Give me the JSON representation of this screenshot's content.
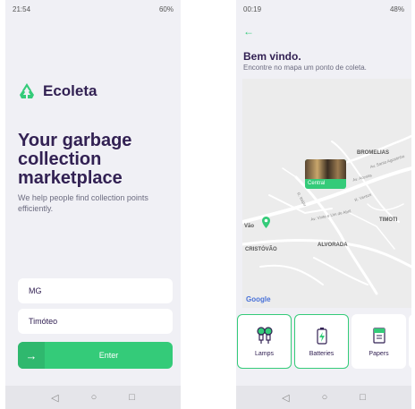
{
  "left_screen": {
    "status": {
      "time": "21:54",
      "battery": "60%"
    },
    "app_name": "Ecoleta",
    "headline": "Your garbage collection marketplace",
    "subtitle": "We help people find collection points efficiently.",
    "uf_value": "MG",
    "city_value": "Timóteo",
    "enter_label": "Enter",
    "enter_icon": "→",
    "nav": {
      "back": "◁",
      "home": "○",
      "recent": "□"
    }
  },
  "right_screen": {
    "status": {
      "time": "00:19",
      "battery": "48%"
    },
    "back_icon": "←",
    "title": "Bem vindo.",
    "subtitle": "Encontre no mapa um ponto de coleta.",
    "map": {
      "marker_label": "Central",
      "labels": [
        "BROMELIAS",
        "TIMOTI",
        "ALVORADA",
        "CRISTÓVÃO",
        "Vão"
      ],
      "streets": [
        "Av. Santo Agostinho",
        "Av. Acesita",
        "Av. Vinte e Um de Abril",
        "R. Itaipu",
        "R. Ventos"
      ],
      "attribution": "Google"
    },
    "items": [
      {
        "label": "Lamps",
        "selected": true
      },
      {
        "label": "Batteries",
        "selected": true
      },
      {
        "label": "Papers",
        "selected": false
      }
    ],
    "nav": {
      "back": "◁",
      "home": "○",
      "recent": "□"
    }
  },
  "colors": {
    "primary": "#34cb79",
    "title": "#322153",
    "text": "#6c6c80",
    "background": "#f0f0f5"
  }
}
